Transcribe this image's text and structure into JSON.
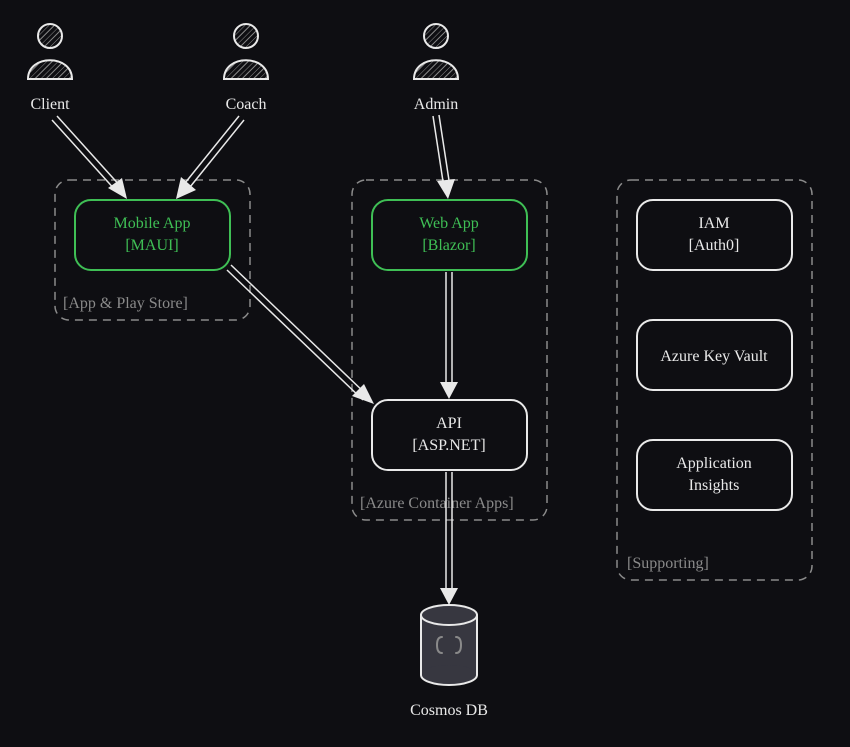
{
  "actors": {
    "client": "Client",
    "coach": "Coach",
    "admin": "Admin"
  },
  "groups": {
    "appStore": "[App & Play Store]",
    "containerApps": "[Azure Container Apps]",
    "supporting": "[Supporting]"
  },
  "nodes": {
    "mobileApp": {
      "l1": "Mobile App",
      "l2": "[MAUI]"
    },
    "webApp": {
      "l1": "Web App",
      "l2": "[Blazor]"
    },
    "api": {
      "l1": "API",
      "l2": "[ASP.NET]"
    },
    "iam": {
      "l1": "IAM",
      "l2": "[Auth0]"
    },
    "keyVault": {
      "l1": "Azure Key Vault"
    },
    "appInsights": {
      "l1": "Application",
      "l2": "Insights"
    },
    "cosmos": {
      "l1": "Cosmos DB"
    }
  }
}
